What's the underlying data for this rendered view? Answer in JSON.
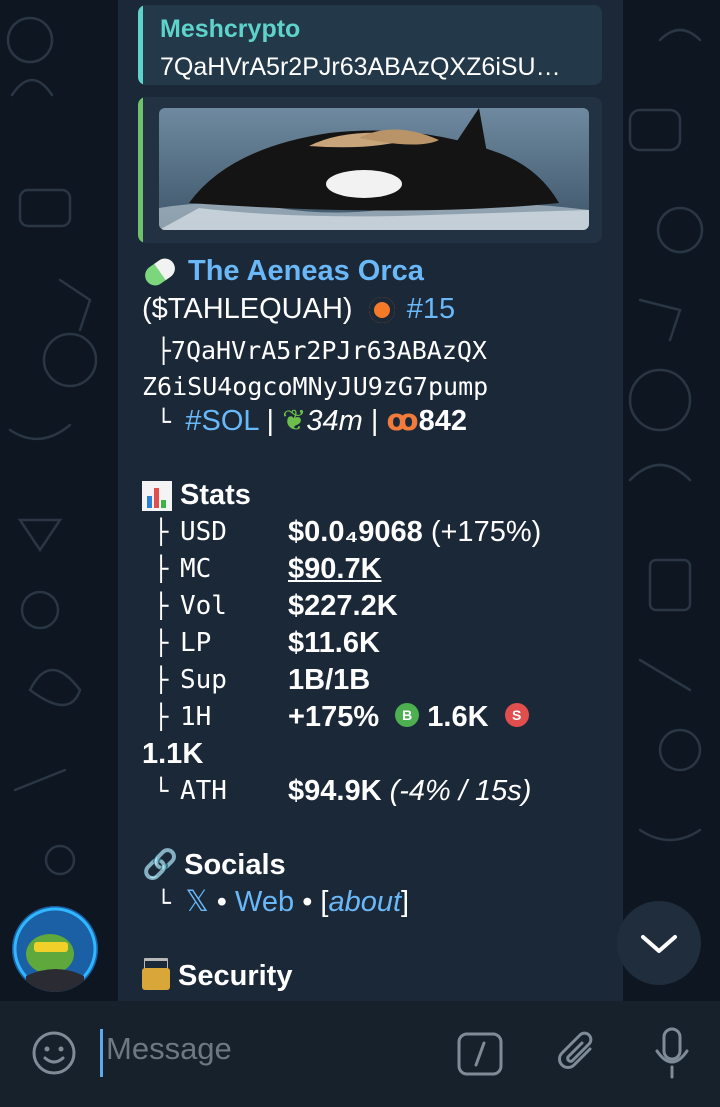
{
  "reply": {
    "author": "Meshcrypto",
    "text": "7QaHVrA5r2PJr63ABAzQXZ6iSU…"
  },
  "token": {
    "pill_emoji": "💊",
    "name": "The Aeneas Orca",
    "ticker": "($TAHLEQUAH)",
    "rank": "#15",
    "address_line1": "7QaHVrA5r2PJr63ABAzQX",
    "address_line2": "Z6iSU4ogcoMNyJU9zG7pump",
    "chain": "#SOL",
    "age": "34m",
    "views": "842"
  },
  "stats": {
    "header": "Stats",
    "usd_label": "USD",
    "usd_value": "$0.0₄9068",
    "usd_change": "(+175%)",
    "mc_label": "MC",
    "mc_value": "$90.7K",
    "vol_label": "Vol",
    "vol_value": "$227.2K",
    "lp_label": "LP",
    "lp_value": "$11.6K",
    "sup_label": "Sup",
    "sup_value": "1B/1B",
    "h1_label": "1H",
    "h1_change": "+175%",
    "buy_badge": "B",
    "buy_value": "1.6K",
    "sell_badge": "S",
    "sell_value": "1.1K",
    "ath_label": "ATH",
    "ath_value": "$94.9K",
    "ath_note": "(-4% / 15s)"
  },
  "socials": {
    "header": "Socials",
    "x_link": "𝕏",
    "web_link": "Web",
    "about_open": "[",
    "about_link": "about",
    "about_close": "]",
    "sep": "•"
  },
  "security": {
    "header": "Security"
  },
  "composer": {
    "placeholder": "Message"
  },
  "colors": {
    "background": "#0e1621",
    "bubble": "#1b2838",
    "link": "#6ab8f7",
    "reply_accent": "#5ed3c9",
    "preview_accent": "#6fc26a",
    "buy": "#4caf50",
    "sell": "#e04e4e"
  }
}
